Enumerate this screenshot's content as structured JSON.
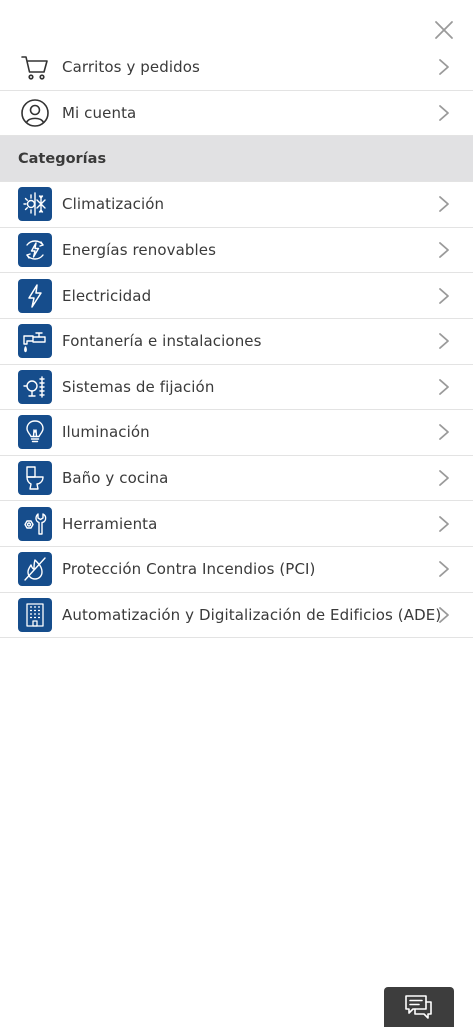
{
  "menu": {
    "close_icon": "close-icon",
    "top_items": [
      {
        "label": "Carritos y pedidos",
        "icon": "cart-icon"
      },
      {
        "label": "Mi cuenta",
        "icon": "user-icon"
      }
    ],
    "section_title": "Categorías",
    "categories": [
      {
        "label": "Climatización",
        "icon": "climate-icon"
      },
      {
        "label": "Energías renovables",
        "icon": "renewable-energy-icon"
      },
      {
        "label": "Electricidad",
        "icon": "lightning-icon"
      },
      {
        "label": "Fontanería e instalaciones",
        "icon": "faucet-icon"
      },
      {
        "label": "Sistemas de fijación",
        "icon": "fixing-icon"
      },
      {
        "label": "Iluminación",
        "icon": "lightbulb-icon"
      },
      {
        "label": "Baño y cocina",
        "icon": "toilet-icon"
      },
      {
        "label": "Herramienta",
        "icon": "wrench-icon"
      },
      {
        "label": "Protección Contra Incendios (PCI)",
        "icon": "fire-protection-icon"
      },
      {
        "label": "Automatización y Digitalización de Edificios (ADE)",
        "icon": "building-icon"
      }
    ]
  },
  "chat": {
    "icon": "chat-icon"
  },
  "colors": {
    "category_icon_bg": "#164d8c",
    "section_bg": "#e1e1e3",
    "chat_bg": "#3d3d3d",
    "divider": "#e3e3e3"
  }
}
